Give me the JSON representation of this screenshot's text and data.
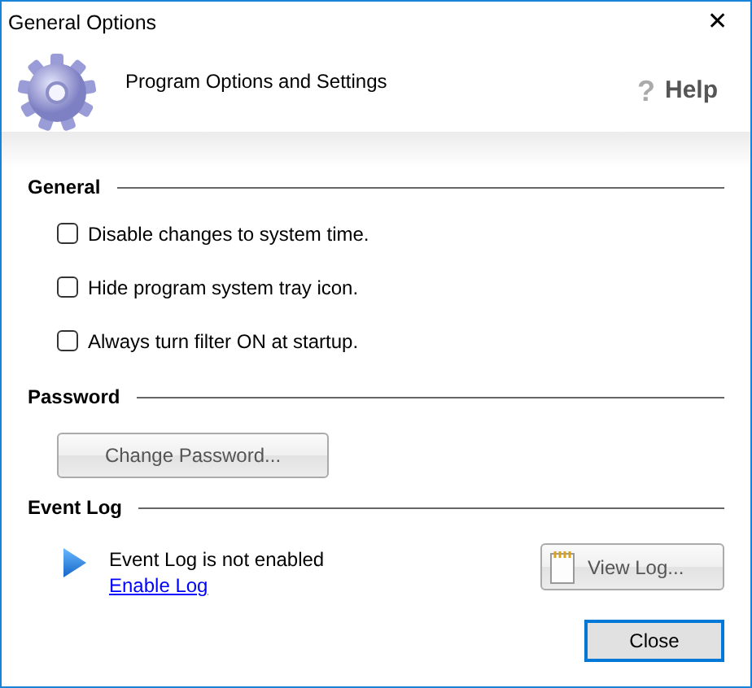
{
  "window": {
    "title": "General Options",
    "close_glyph": "✕"
  },
  "header": {
    "subtitle": "Program Options and Settings",
    "help_glyph": "?",
    "help_label": "Help"
  },
  "sections": [
    {
      "kind": "checks",
      "title": "General",
      "options": [
        {
          "label": "Disable changes to system time.",
          "checked": false
        },
        {
          "label": "Hide program system tray icon.",
          "checked": false
        },
        {
          "label": "Always turn filter ON at startup.",
          "checked": false
        }
      ]
    },
    {
      "kind": "button",
      "title": "Password",
      "button": "Change Password..."
    },
    {
      "kind": "log",
      "title": "Event Log",
      "status": "Event Log is not enabled",
      "link": "Enable Log",
      "button": "View Log..."
    }
  ],
  "footer": {
    "button": "Close"
  }
}
